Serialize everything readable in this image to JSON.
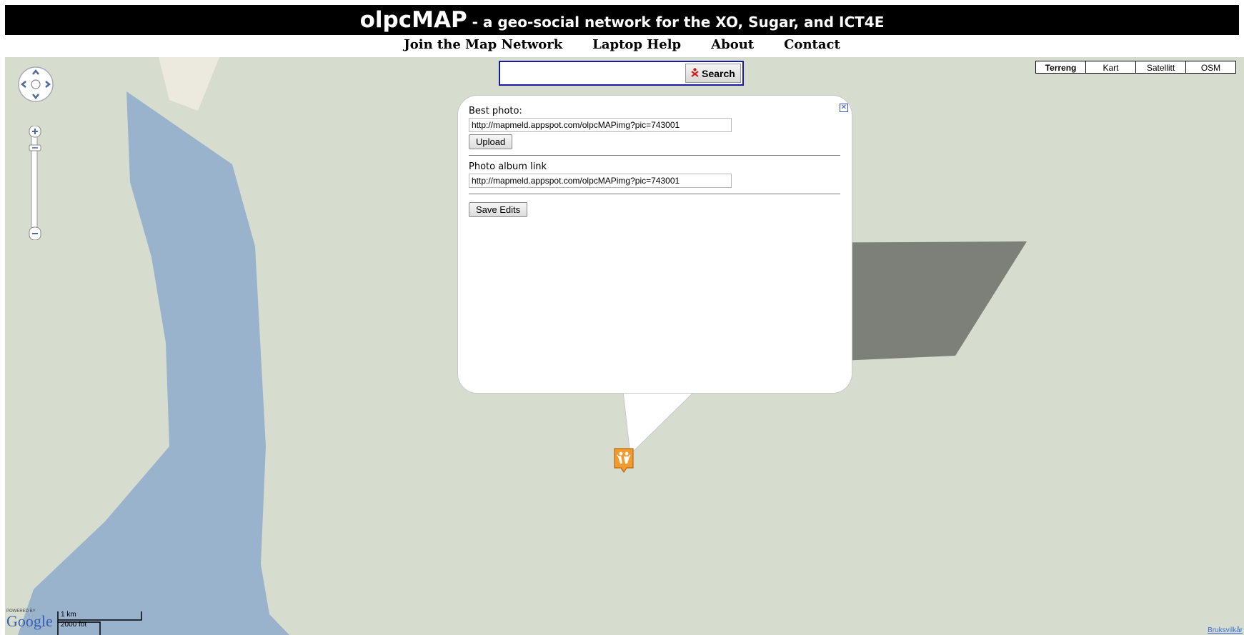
{
  "header": {
    "title": "olpcMAP",
    "subtitle": " - a geo-social network for the XO, Sugar, and ICT4E"
  },
  "nav": {
    "items": [
      "Join the Map Network",
      "Laptop Help",
      "About",
      "Contact"
    ]
  },
  "search": {
    "value": "",
    "button_label": "Search"
  },
  "map_types": {
    "items": [
      "Terreng",
      "Kart",
      "Satellitt",
      "OSM"
    ],
    "selected": "Terreng"
  },
  "popup": {
    "best_photo_label": "Best photo:",
    "best_photo_value": "http://mapmeld.appspot.com/olpcMAPimg?pic=743001",
    "upload_label": "Upload",
    "album_label": "Photo album link",
    "album_value": "http://mapmeld.appspot.com/olpcMAPimg?pic=743001",
    "save_label": "Save Edits"
  },
  "footer": {
    "powered_by": "POWERED BY",
    "google": "Google",
    "scale_metric": "1 km",
    "scale_imperial": "2000 fot",
    "terms": "Bruksvilkår"
  },
  "colors": {
    "land": "#d6ddcf",
    "water": "#9ab3cd",
    "marker": "#f39a2c"
  }
}
